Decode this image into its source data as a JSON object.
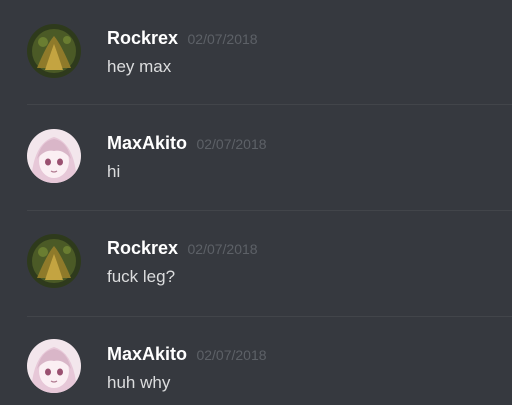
{
  "messages": [
    {
      "author": "Rockrex",
      "timestamp": "02/07/2018",
      "text": "hey max",
      "avatar": "rockrex-avatar"
    },
    {
      "author": "MaxAkito",
      "timestamp": "02/07/2018",
      "text": "hi",
      "avatar": "maxakito-avatar"
    },
    {
      "author": "Rockrex",
      "timestamp": "02/07/2018",
      "text": "fuck leg?",
      "avatar": "rockrex-avatar"
    },
    {
      "author": "MaxAkito",
      "timestamp": "02/07/2018",
      "text": "huh why",
      "avatar": "maxakito-avatar"
    }
  ],
  "colors": {
    "background": "#36393f",
    "username": "#ffffff",
    "timestamp": "#5d6167",
    "message_text": "#dcddde",
    "divider": "#42454a"
  }
}
